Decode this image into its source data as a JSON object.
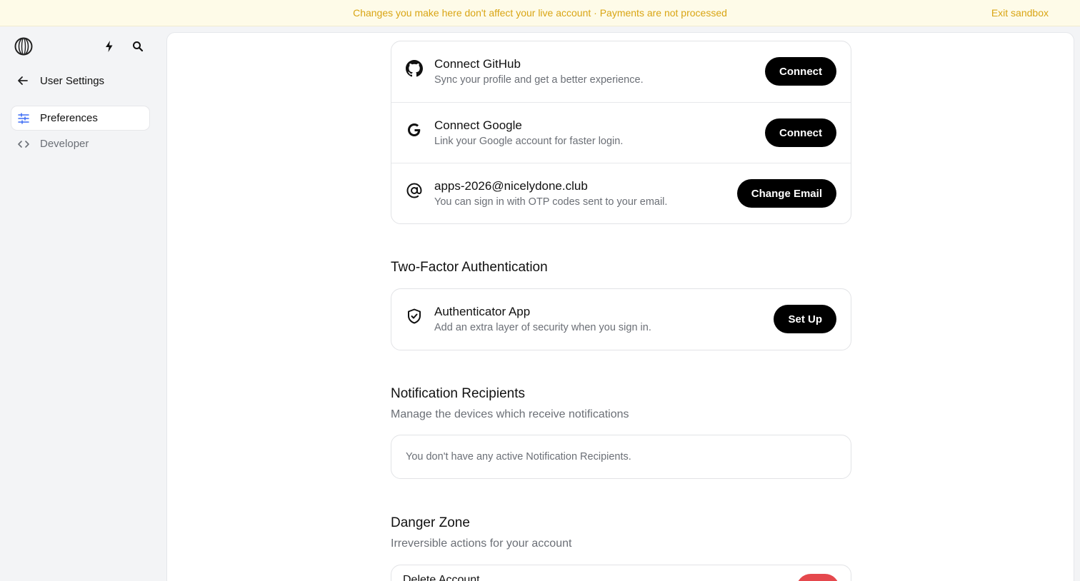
{
  "banner": {
    "message": "Changes you make here don't affect your live account · Payments are not processed",
    "exit_label": "Exit sandbox"
  },
  "sidebar": {
    "back_label": "User Settings",
    "items": [
      {
        "label": "Preferences",
        "icon": "sliders-icon",
        "active": true
      },
      {
        "label": "Developer",
        "icon": "code-icon",
        "active": false
      }
    ]
  },
  "connections": [
    {
      "title": "Connect GitHub",
      "subtitle": "Sync your profile and get a better experience.",
      "button": "Connect",
      "icon": "github-icon"
    },
    {
      "title": "Connect Google",
      "subtitle": "Link your Google account for faster login.",
      "button": "Connect",
      "icon": "google-icon"
    },
    {
      "title": "apps-2026@nicelydone.club",
      "subtitle": "You can sign in with OTP codes sent to your email.",
      "button": "Change Email",
      "icon": "at-sign-icon"
    }
  ],
  "two_factor": {
    "title": "Two-Factor Authentication",
    "row": {
      "title": "Authenticator App",
      "subtitle": "Add an extra layer of security when you sign in.",
      "button": "Set Up",
      "icon": "shield-check-icon"
    }
  },
  "notifications": {
    "title": "Notification Recipients",
    "subtitle": "Manage the devices which receive notifications",
    "empty_text": "You don't have any active Notification Recipients."
  },
  "danger_zone": {
    "title": "Danger Zone",
    "subtitle": "Irreversible actions for your account",
    "row_title": "Delete Account"
  },
  "colors": {
    "banner_text": "#d9a514",
    "banner_bg": "#fefbe8",
    "accent": "#3b6cf5",
    "button": "#000000",
    "danger": "#e5484d"
  }
}
